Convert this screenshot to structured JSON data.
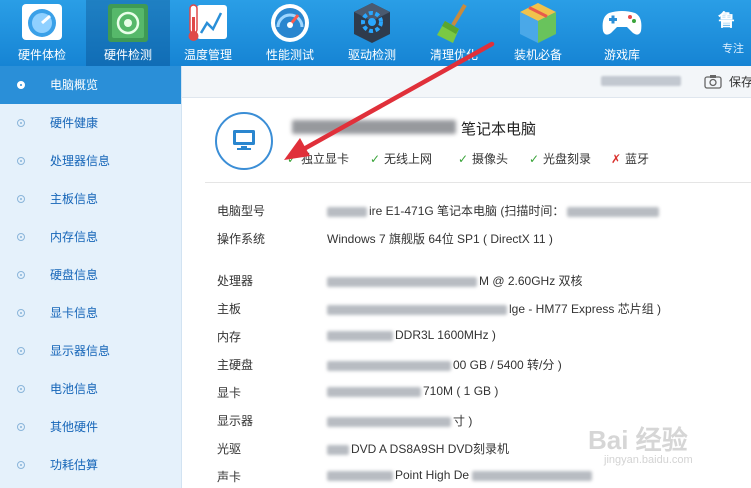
{
  "toolbar": {
    "items": [
      {
        "label": "硬件体检",
        "icon": "dashboard-icon"
      },
      {
        "label": "硬件检测",
        "icon": "motherboard-icon"
      },
      {
        "label": "温度管理",
        "icon": "thermometer-icon"
      },
      {
        "label": "性能测试",
        "icon": "speedometer-icon"
      },
      {
        "label": "驱动检测",
        "icon": "gear-box-icon"
      },
      {
        "label": "清理优化",
        "icon": "broom-icon"
      },
      {
        "label": "装机必备",
        "icon": "package-box-icon"
      },
      {
        "label": "游戏库",
        "icon": "gamepad-icon"
      }
    ],
    "active_index": 1,
    "brand": "鲁",
    "brand_sub": "专注"
  },
  "sidebar": {
    "items": [
      {
        "label": "电脑概览"
      },
      {
        "label": "硬件健康"
      },
      {
        "label": "处理器信息"
      },
      {
        "label": "主板信息"
      },
      {
        "label": "内存信息"
      },
      {
        "label": "硬盘信息"
      },
      {
        "label": "显卡信息"
      },
      {
        "label": "显示器信息"
      },
      {
        "label": "电池信息"
      },
      {
        "label": "其他硬件"
      },
      {
        "label": "功耗估算"
      }
    ],
    "active_index": 0
  },
  "header": {
    "save_label": "保存"
  },
  "summary": {
    "title": "笔记本电脑",
    "features": [
      {
        "label": "独立显卡",
        "ok": true
      },
      {
        "label": "无线上网",
        "ok": true
      },
      {
        "label": "摄像头",
        "ok": true
      },
      {
        "label": "光盘刻录",
        "ok": true
      },
      {
        "label": "蓝牙",
        "ok": false
      }
    ]
  },
  "details": {
    "model": {
      "key": "电脑型号",
      "value": "ire E1-471G 笔记本电脑 (扫描时间："
    },
    "os": {
      "key": "操作系统",
      "value": "Windows 7 旗舰版 64位 SP1 ( DirectX 11 )"
    },
    "cpu": {
      "key": "处理器",
      "value": "M @ 2.60GHz 双核"
    },
    "board": {
      "key": "主板",
      "value": "lge - HM77 Express 芯片组 )"
    },
    "memory": {
      "key": "内存",
      "value": "DDR3L 1600MHz )"
    },
    "disk": {
      "key": "主硬盘",
      "value": "00 GB / 5400 转/分 )"
    },
    "gpu": {
      "key": "显卡",
      "value": "710M ( 1 GB )"
    },
    "monitor": {
      "key": "显示器",
      "value": "寸 )"
    },
    "optical": {
      "key": "光驱",
      "value": "DVD A DS8A9SH DVD刻录机"
    },
    "sound": {
      "key": "声卡",
      "value": "Point High De"
    }
  },
  "watermark": {
    "text": "Bai 经验",
    "sub": "jingyan.baidu.com"
  },
  "colors": {
    "toolbar": "#1684d4",
    "sidebar_active": "#2a8fd8",
    "sidebar_bg": "#e5f1fb",
    "ok": "#3aa43a",
    "no": "#d9302c",
    "annotation_arrow": "#e0303a"
  }
}
